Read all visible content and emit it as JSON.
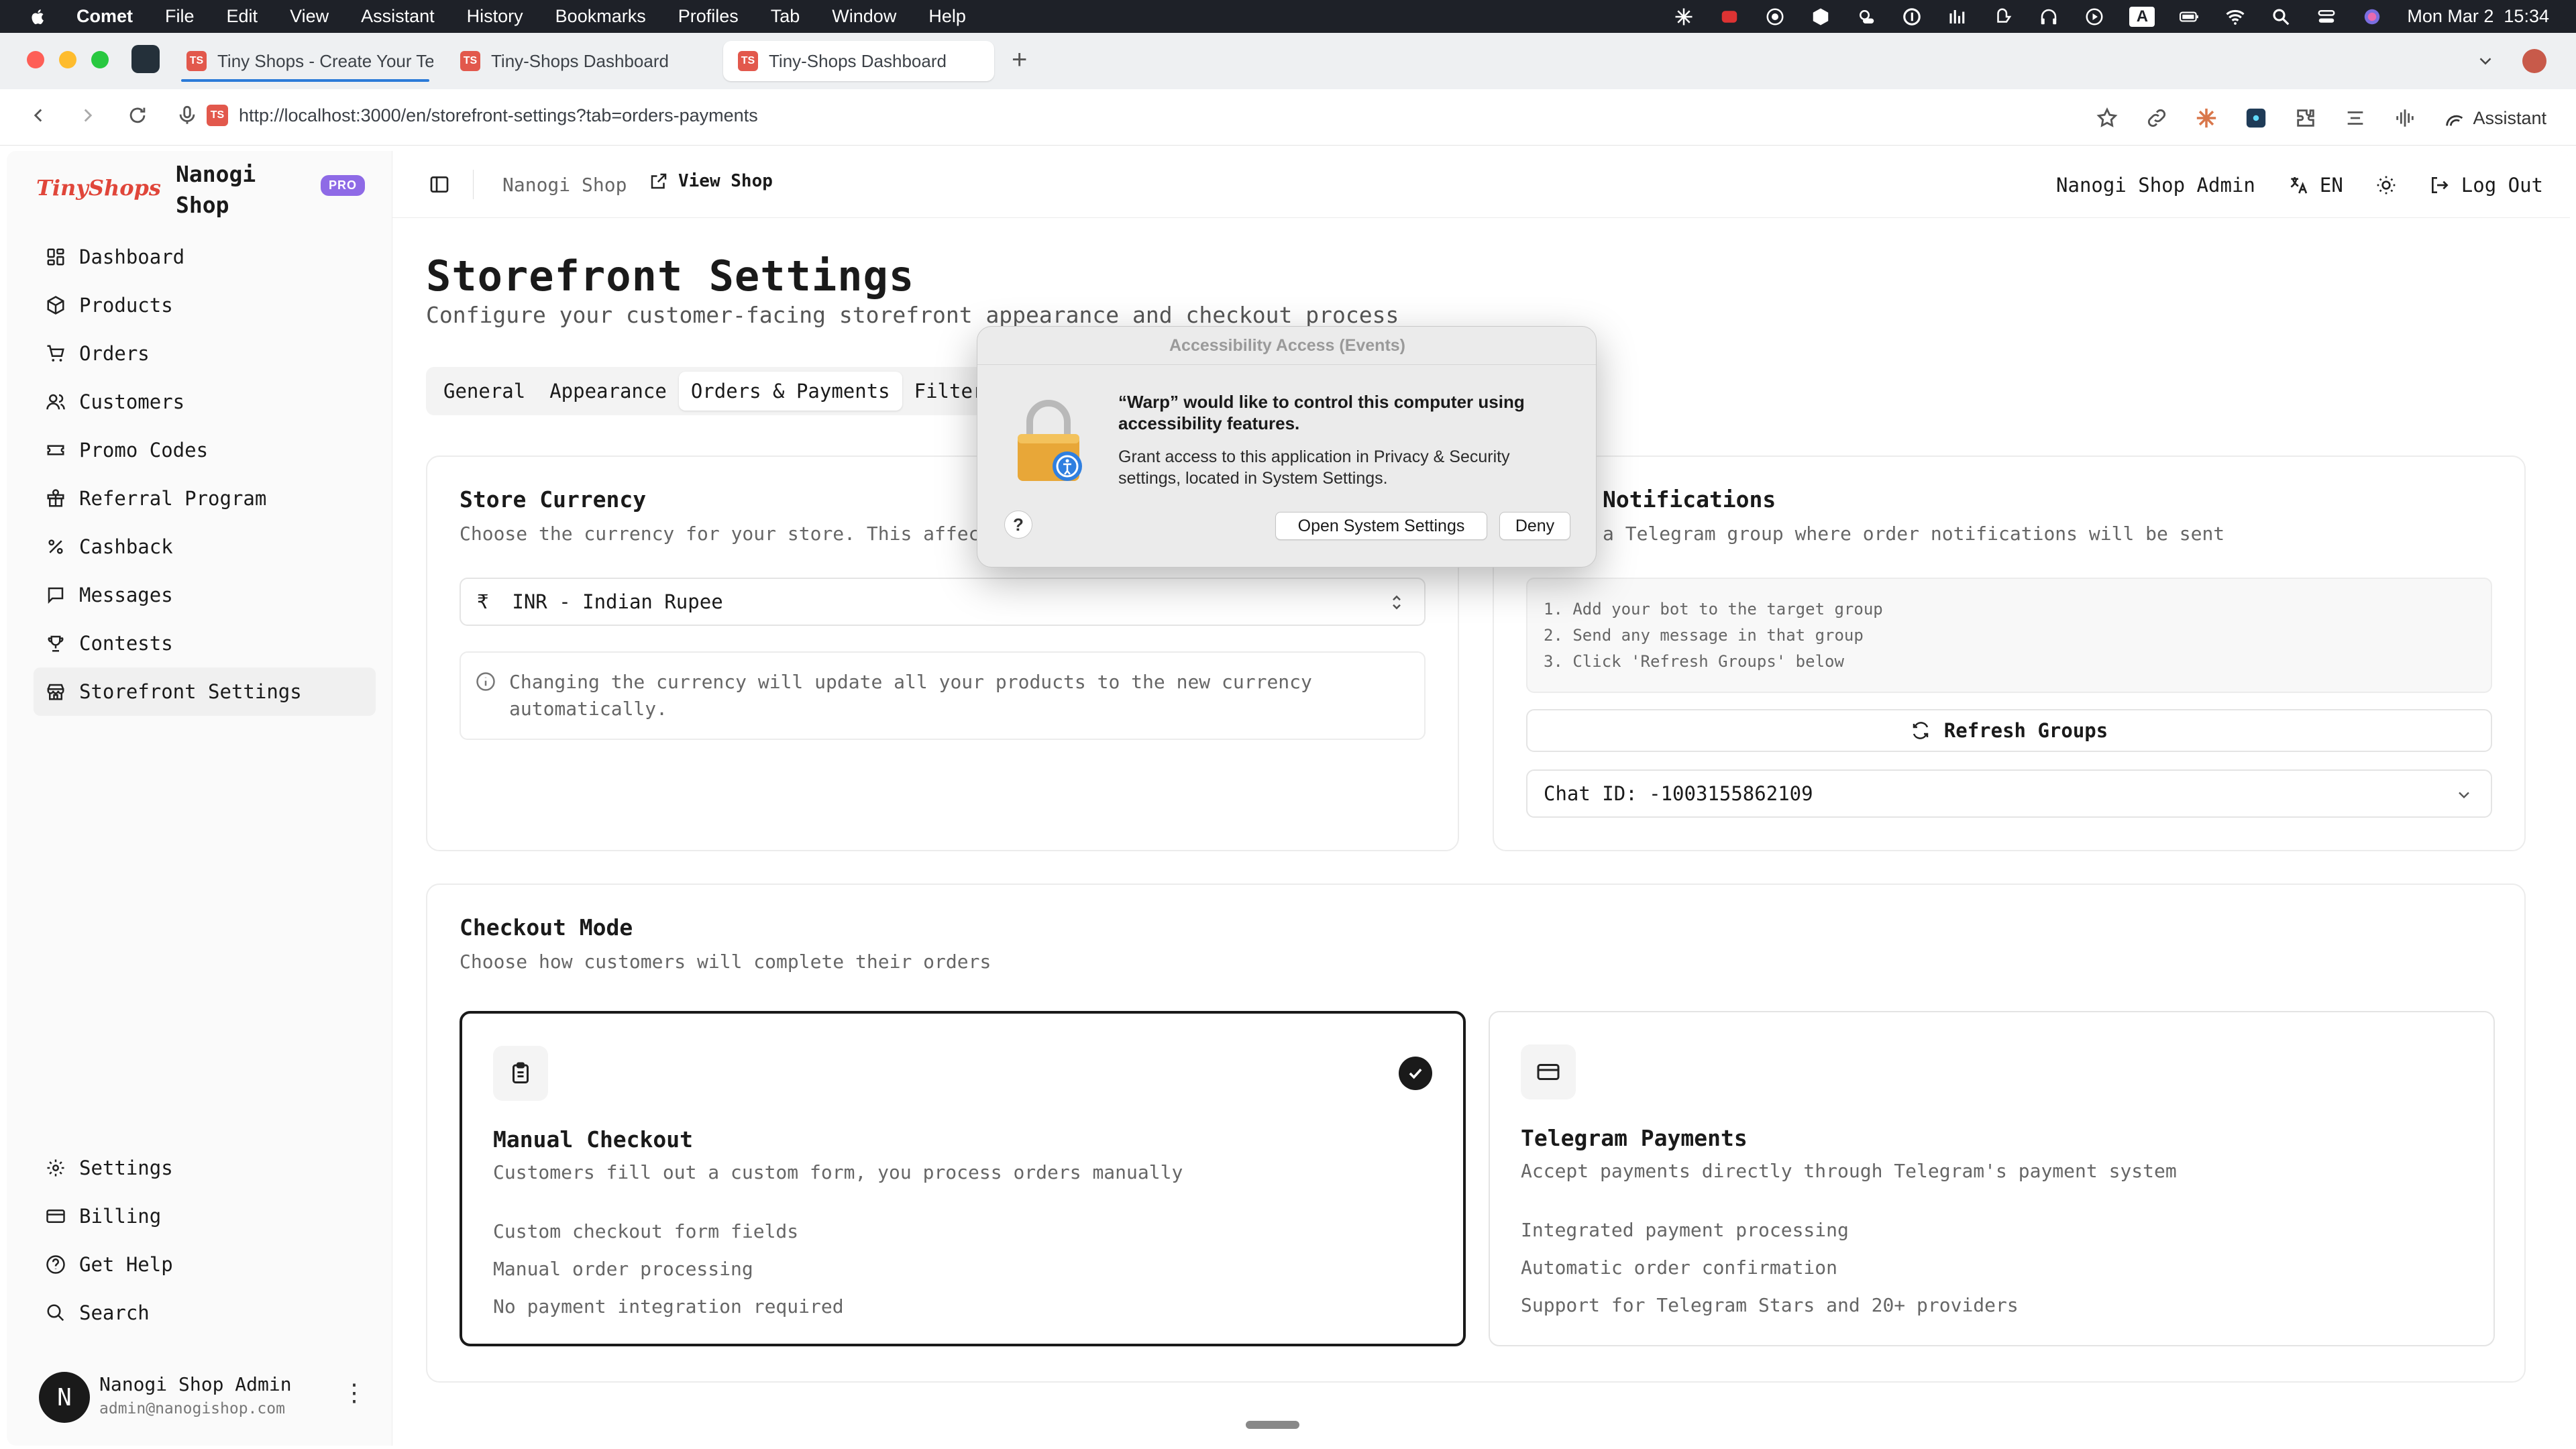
{
  "menubar": {
    "app": "Comet",
    "items": [
      "File",
      "Edit",
      "View",
      "Assistant",
      "History",
      "Bookmarks",
      "Profiles",
      "Tab",
      "Window",
      "Help"
    ],
    "datetime": "Mon Mar 2  15:34",
    "status_icons": [
      "perplexity-icon",
      "notification-badge-icon",
      "creative-cloud-icon",
      "box-icon",
      "weather-icon",
      "onepassword-icon",
      "stats-icon",
      "brain-icon",
      "headphones-icon",
      "play-icon",
      "keyboard-a-icon",
      "battery-icon",
      "wifi-icon",
      "search-icon",
      "control-center-icon",
      "siri-icon"
    ]
  },
  "browser": {
    "tabs": [
      {
        "title": "Tiny Shops - Create Your Tel",
        "favicon": "TS"
      },
      {
        "title": "Tiny-Shops Dashboard",
        "favicon": "TS"
      },
      {
        "title": "Tiny-Shops Dashboard",
        "favicon": "TS"
      }
    ],
    "new_tab": "+",
    "url": "http://localhost:3000/en/storefront-settings?tab=orders-payments",
    "assistant_label": "Assistant"
  },
  "sidebar": {
    "logo": "TinyShops",
    "shop_name": "Nanogi Shop",
    "badge": "PRO",
    "items": [
      {
        "label": "Dashboard",
        "icon": "dashboard-icon"
      },
      {
        "label": "Products",
        "icon": "package-icon"
      },
      {
        "label": "Orders",
        "icon": "cart-icon"
      },
      {
        "label": "Customers",
        "icon": "users-icon"
      },
      {
        "label": "Promo Codes",
        "icon": "ticket-icon"
      },
      {
        "label": "Referral Program",
        "icon": "gift-icon"
      },
      {
        "label": "Cashback",
        "icon": "percent-icon"
      },
      {
        "label": "Messages",
        "icon": "message-icon"
      },
      {
        "label": "Contests",
        "icon": "trophy-icon"
      },
      {
        "label": "Storefront Settings",
        "icon": "store-icon"
      }
    ],
    "bottom_items": [
      {
        "label": "Settings",
        "icon": "gear-icon"
      },
      {
        "label": "Billing",
        "icon": "credit-card-icon"
      },
      {
        "label": "Get Help",
        "icon": "help-circle-icon"
      },
      {
        "label": "Search",
        "icon": "search-icon"
      }
    ],
    "user": {
      "initial": "N",
      "name": "Nanogi Shop Admin",
      "email": "admin@nanogishop.com"
    }
  },
  "topbar": {
    "shop": "Nanogi Shop",
    "view_shop": "View Shop",
    "admin": "Nanogi Shop Admin",
    "language": "EN",
    "logout": "Log Out"
  },
  "page": {
    "title": "Storefront Settings",
    "subtitle": "Configure your customer-facing storefront appearance and checkout process",
    "tabs": [
      "General",
      "Appearance",
      "Orders & Payments",
      "Filters"
    ],
    "active_tab": "Orders & Payments"
  },
  "currency": {
    "title": "Store Currency",
    "desc": "Choose the currency for your store. This affec",
    "value": "₹  INR - Indian Rupee",
    "info": "Changing the currency will update all your products to the new currency automatically."
  },
  "notifications": {
    "title": "Notifications",
    "desc": "a Telegram group where order notifications will be sent",
    "steps": [
      "1. Add your bot to the target group",
      "2. Send any message in that group",
      "3. Click 'Refresh Groups' below"
    ],
    "refresh": "Refresh Groups",
    "chat": "Chat ID: -1003155862109"
  },
  "checkout": {
    "title": "Checkout Mode",
    "desc": "Choose how customers will complete their orders",
    "modes": [
      {
        "title": "Manual Checkout",
        "desc": "Customers fill out a custom form, you process orders manually",
        "features": [
          "Custom checkout form fields",
          "Manual order processing",
          "No payment integration required"
        ],
        "selected": true
      },
      {
        "title": "Telegram Payments",
        "desc": "Accept payments directly through Telegram's payment system",
        "features": [
          "Integrated payment processing",
          "Automatic order confirmation",
          "Support for Telegram Stars and 20+ providers"
        ],
        "selected": false
      }
    ]
  },
  "dialog": {
    "title": "Accessibility Access (Events)",
    "heading": "“Warp” would like to control this computer using accessibility features.",
    "body": "Grant access to this application in Privacy & Security settings, located in System Settings.",
    "help": "?",
    "open_btn": "Open System Settings",
    "deny_btn": "Deny"
  },
  "colors": {
    "accent": "#e0463a",
    "pro_badge": "#8e6ae6",
    "menubar": "#1e2128",
    "tab_underline": "#2b7bd8"
  }
}
